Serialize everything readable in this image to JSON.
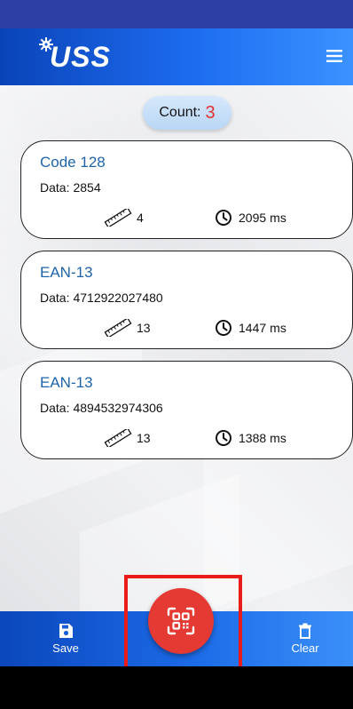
{
  "app": {
    "logo_text": "USS",
    "menu_icon": "hamburger-menu-icon"
  },
  "count": {
    "label": "Count:",
    "value": "3"
  },
  "cards": [
    {
      "type": "Code 128",
      "data_label": "Data:",
      "data": "2854",
      "length": "4",
      "time": "2095",
      "time_unit": "ms"
    },
    {
      "type": "EAN-13",
      "data_label": "Data:",
      "data": "4712922027480",
      "length": "13",
      "time": "1447",
      "time_unit": "ms"
    },
    {
      "type": "EAN-13",
      "data_label": "Data:",
      "data": "4894532974306",
      "length": "13",
      "time": "1388",
      "time_unit": "ms"
    }
  ],
  "bottom_bar": {
    "save_label": "Save",
    "clear_label": "Clear",
    "scan_icon": "qr-scan-icon"
  },
  "colors": {
    "brand_blue": "#1d6cf0",
    "status_bar": "#2d3ea5",
    "accent_red": "#e43a33",
    "count_value": "#e23232",
    "highlight": "#e91b1b",
    "barcode_type": "#1f64a9"
  }
}
